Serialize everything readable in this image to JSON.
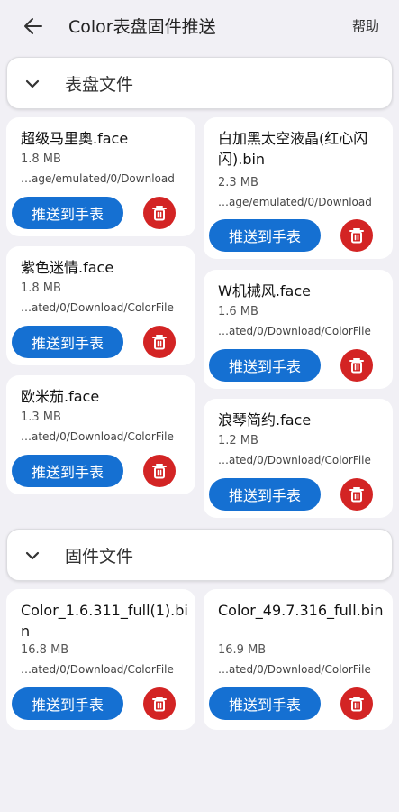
{
  "appbar": {
    "title": "Color表盘固件推送",
    "help_label": "帮助"
  },
  "sections": {
    "watchface": {
      "title": "表盘文件"
    },
    "firmware": {
      "title": "固件文件"
    }
  },
  "watchface_files": [
    {
      "name": "超级马里奥.face",
      "size": "1.8 MB",
      "path": "…age/emulated/0/Download",
      "push_label": "推送到手表"
    },
    {
      "name": "白加黑太空液晶(红心闪闪).bin",
      "size": "2.3 MB",
      "path": "…age/emulated/0/Download",
      "push_label": "推送到手表"
    },
    {
      "name": "紫色迷情.face",
      "size": "1.8 MB",
      "path": "…ated/0/Download/ColorFile",
      "push_label": "推送到手表"
    },
    {
      "name": "W机械风.face",
      "size": "1.6 MB",
      "path": "…ated/0/Download/ColorFile",
      "push_label": "推送到手表"
    },
    {
      "name": "欧米茄.face",
      "size": "1.3 MB",
      "path": "…ated/0/Download/ColorFile",
      "push_label": "推送到手表"
    },
    {
      "name": "浪琴简约.face",
      "size": "1.2 MB",
      "path": "…ated/0/Download/ColorFile",
      "push_label": "推送到手表"
    }
  ],
  "firmware_files": [
    {
      "name": "Color_1.6.311_full(1).bin",
      "size": "16.8 MB",
      "path": "…ated/0/Download/ColorFile",
      "push_label": "推送到手表"
    },
    {
      "name": "Color_49.7.316_full.bin",
      "size": "16.9 MB",
      "path": "…ated/0/Download/ColorFile",
      "push_label": "推送到手表"
    }
  ],
  "icons": {
    "back": "arrow-left-icon",
    "collapse": "chevron-down-icon",
    "delete": "trash-icon"
  },
  "colors": {
    "primary": "#1570d2",
    "danger": "#d32424",
    "background": "#f1f0f5"
  }
}
